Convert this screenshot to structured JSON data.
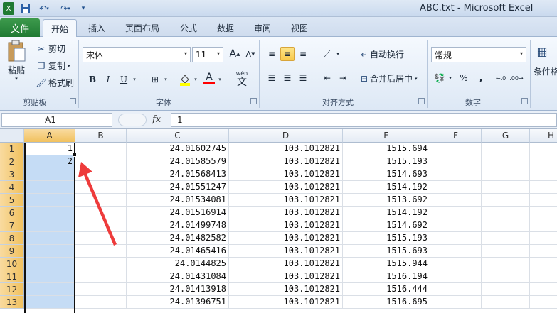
{
  "window": {
    "title": "ABC.txt - Microsoft Excel",
    "qa_icons": [
      "excel-app-icon",
      "save-icon",
      "undo-icon",
      "redo-icon",
      "customize-icon"
    ]
  },
  "tabs": {
    "file": "文件",
    "items": [
      "开始",
      "插入",
      "页面布局",
      "公式",
      "数据",
      "审阅",
      "视图"
    ],
    "active_index": 0
  },
  "ribbon": {
    "clipboard": {
      "paste": "粘贴",
      "cut": "剪切",
      "copy": "复制",
      "format_painter": "格式刷",
      "label": "剪贴板"
    },
    "font": {
      "name": "宋体",
      "size": "11",
      "bold": "B",
      "italic": "I",
      "underline": "U",
      "wen": "wén",
      "wen_char": "文",
      "label": "字体",
      "grow": "A",
      "shrink": "A"
    },
    "alignment": {
      "wrap": "自动换行",
      "merge": "合并后居中",
      "label": "对齐方式"
    },
    "number": {
      "format": "常规",
      "percent": "%",
      "comma": ",",
      "label": "数字"
    },
    "styles": {
      "conditional": "条件格"
    },
    "colors": {
      "fill": "#ffff00",
      "font": "#ff0000",
      "accent": "#1f7a33",
      "selection": "#c5dcf5",
      "header_selected": "#f1c15e"
    }
  },
  "formula_bar": {
    "name_box": "A1",
    "fx": "fx",
    "content": "1"
  },
  "grid": {
    "columns": [
      "A",
      "B",
      "C",
      "D",
      "E",
      "F",
      "G",
      "H"
    ],
    "rows": [
      {
        "num": "1",
        "A": "1",
        "C": "24.01602745",
        "D": "103.1012821",
        "E": "1515.694"
      },
      {
        "num": "2",
        "A": "2",
        "C": "24.01585579",
        "D": "103.1012821",
        "E": "1515.193"
      },
      {
        "num": "3",
        "A": "",
        "C": "24.01568413",
        "D": "103.1012821",
        "E": "1514.693"
      },
      {
        "num": "4",
        "A": "",
        "C": "24.01551247",
        "D": "103.1012821",
        "E": "1514.192"
      },
      {
        "num": "5",
        "A": "",
        "C": "24.01534081",
        "D": "103.1012821",
        "E": "1513.692"
      },
      {
        "num": "6",
        "A": "",
        "C": "24.01516914",
        "D": "103.1012821",
        "E": "1514.192"
      },
      {
        "num": "7",
        "A": "",
        "C": "24.01499748",
        "D": "103.1012821",
        "E": "1514.692"
      },
      {
        "num": "8",
        "A": "",
        "C": "24.01482582",
        "D": "103.1012821",
        "E": "1515.193"
      },
      {
        "num": "9",
        "A": "",
        "C": "24.01465416",
        "D": "103.1012821",
        "E": "1515.693"
      },
      {
        "num": "10",
        "A": "",
        "C": "24.0144825",
        "D": "103.1012821",
        "E": "1515.944"
      },
      {
        "num": "11",
        "A": "",
        "C": "24.01431084",
        "D": "103.1012821",
        "E": "1516.194"
      },
      {
        "num": "12",
        "A": "",
        "C": "24.01413918",
        "D": "103.1012821",
        "E": "1516.444"
      },
      {
        "num": "13",
        "A": "",
        "C": "24.01396751",
        "D": "103.1012821",
        "E": "1516.695"
      }
    ]
  }
}
